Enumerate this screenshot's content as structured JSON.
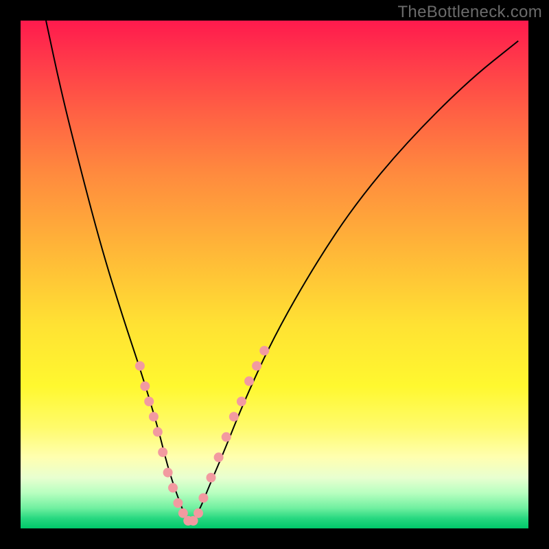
{
  "watermark": "TheBottleneck.com",
  "colors": {
    "background_frame": "#000000",
    "gradient_top": "#ff1a4d",
    "gradient_bottom": "#00c86a",
    "curve_stroke": "#000000",
    "dot_fill": "#f29aa0"
  },
  "chart_data": {
    "type": "line",
    "title": "",
    "xlabel": "",
    "ylabel": "",
    "xlim": [
      0,
      100
    ],
    "ylim": [
      0,
      100
    ],
    "grid": false,
    "legend": false,
    "description": "V-shaped bottleneck curve over vertical rainbow heat gradient; minimum near x≈33, y≈0. Dots cluster along the lower arms of the V.",
    "series": [
      {
        "name": "bottleneck-curve",
        "x": [
          5,
          8,
          12,
          16,
          20,
          24,
          27,
          29,
          31,
          33,
          35,
          37,
          40,
          44,
          50,
          58,
          66,
          76,
          88,
          98
        ],
        "y": [
          100,
          86,
          70,
          55,
          42,
          30,
          20,
          12,
          6,
          1,
          3,
          8,
          15,
          25,
          38,
          52,
          64,
          76,
          88,
          96
        ]
      }
    ],
    "dots": [
      {
        "x": 23.5,
        "y": 32
      },
      {
        "x": 24.5,
        "y": 28
      },
      {
        "x": 25.3,
        "y": 25
      },
      {
        "x": 26.2,
        "y": 22
      },
      {
        "x": 27.0,
        "y": 19
      },
      {
        "x": 28.0,
        "y": 15
      },
      {
        "x": 29.0,
        "y": 11
      },
      {
        "x": 30.0,
        "y": 8
      },
      {
        "x": 31.0,
        "y": 5
      },
      {
        "x": 32.0,
        "y": 3
      },
      {
        "x": 33.0,
        "y": 1.5
      },
      {
        "x": 34.0,
        "y": 1.5
      },
      {
        "x": 35.0,
        "y": 3
      },
      {
        "x": 36.0,
        "y": 6
      },
      {
        "x": 37.5,
        "y": 10
      },
      {
        "x": 39.0,
        "y": 14
      },
      {
        "x": 40.5,
        "y": 18
      },
      {
        "x": 42.0,
        "y": 22
      },
      {
        "x": 43.5,
        "y": 25
      },
      {
        "x": 45.0,
        "y": 29
      },
      {
        "x": 46.5,
        "y": 32
      },
      {
        "x": 48.0,
        "y": 35
      }
    ]
  }
}
